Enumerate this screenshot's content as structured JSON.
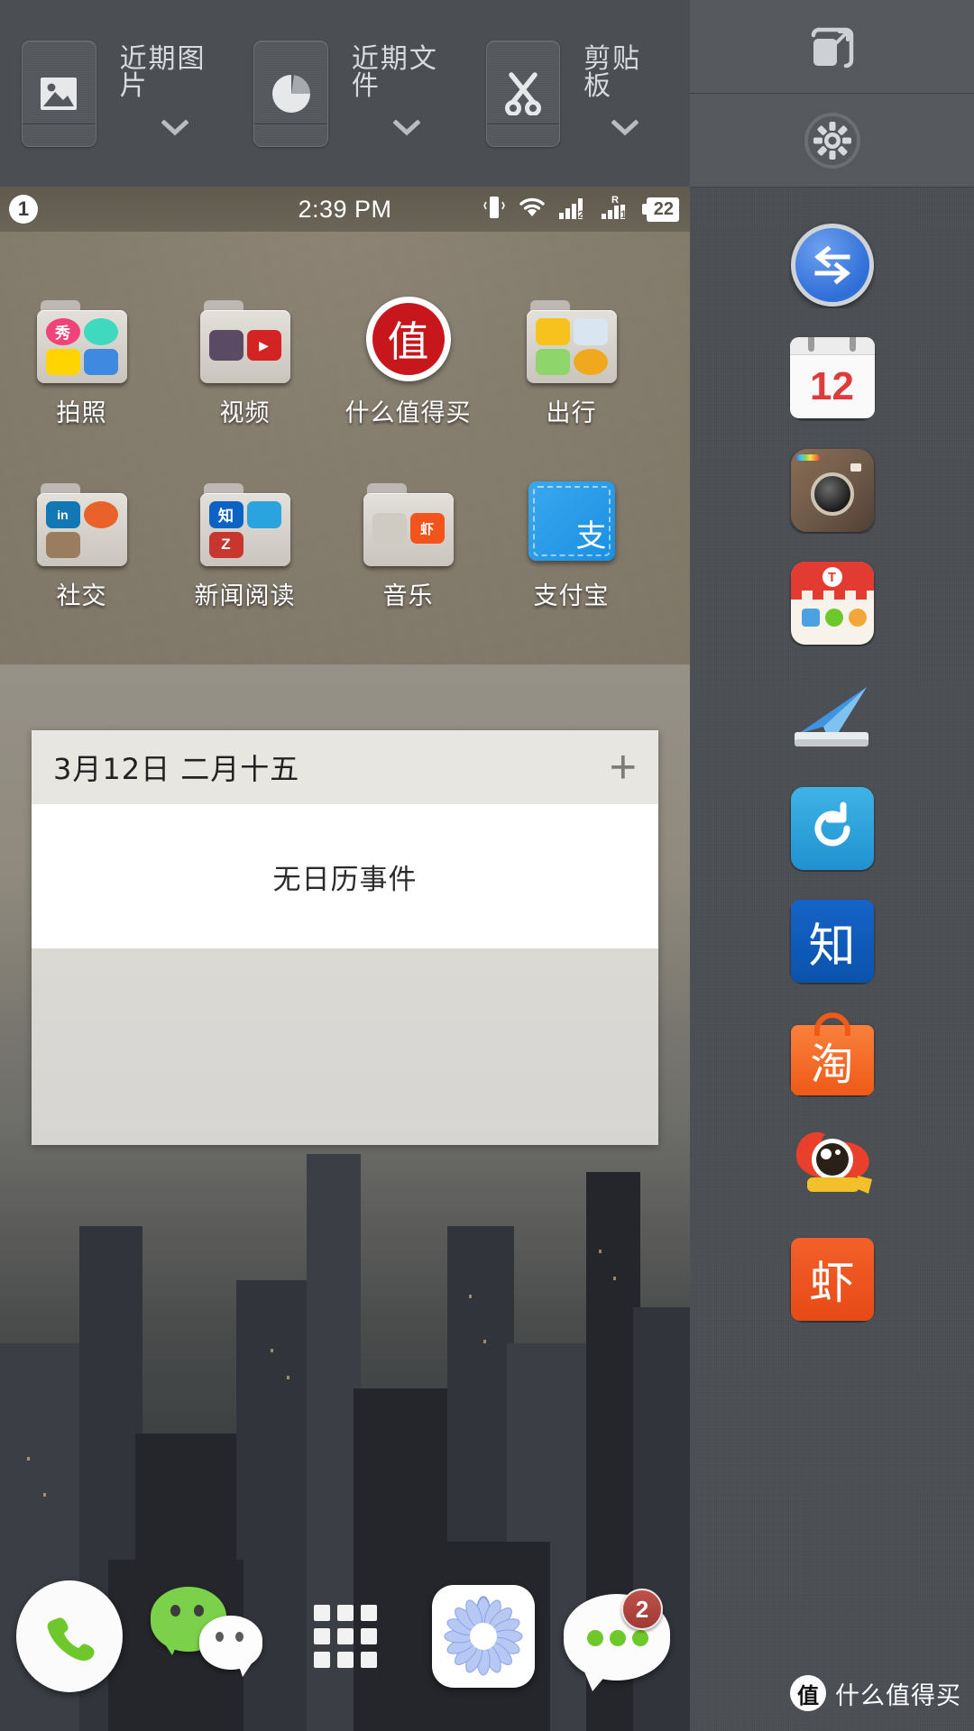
{
  "toolbar": {
    "items": [
      {
        "label": "近期图片",
        "icon": "image-icon",
        "caret": "chevron-down-icon"
      },
      {
        "label": "近期文件",
        "icon": "pie-chart-icon",
        "caret": "chevron-down-icon"
      },
      {
        "label": "剪贴板",
        "icon": "scissors-icon",
        "caret": "chevron-down-icon"
      }
    ]
  },
  "sidebar_header": {
    "multiwindow_icon": "multiwindow-expand-icon",
    "settings_icon": "gear-icon"
  },
  "statusbar": {
    "notification_count": "1",
    "time": "2:39 PM",
    "icons": [
      "vibrate-icon",
      "wifi-icon",
      "signal-2-icon",
      "signal-r-1-icon"
    ],
    "battery": "22"
  },
  "home": {
    "rows": [
      [
        {
          "label": "拍照",
          "type": "folder",
          "name": "folder-camera",
          "minis": [
            {
              "text": "秀",
              "bg": "#f0437a",
              "shape": "circle"
            },
            {
              "text": "",
              "bg": "#3fd9c0",
              "shape": "circle"
            },
            {
              "text": "",
              "bg": "#ffd400",
              "shape": "rounded"
            },
            {
              "text": "",
              "bg": "#3f8ae0",
              "shape": "rounded"
            }
          ]
        },
        {
          "label": "视频",
          "type": "folder",
          "name": "folder-video",
          "minis": [
            {
              "text": "",
              "bg": "#5a4a63",
              "shape": "rounded"
            },
            {
              "text": "▶",
              "bg": "#d32323",
              "shape": "rounded"
            },
            {
              "text": "",
              "bg": "#00000000",
              "shape": "none"
            },
            {
              "text": "",
              "bg": "#00000000",
              "shape": "none"
            }
          ],
          "two": true
        },
        {
          "label": "什么值得买",
          "type": "app",
          "name": "app-smzdm",
          "glyph": "值",
          "style": "smzdm"
        },
        {
          "label": "出行",
          "type": "folder",
          "name": "folder-travel",
          "minis": [
            {
              "text": "",
              "bg": "#f7c11e",
              "shape": "rounded"
            },
            {
              "text": "",
              "bg": "#d9e6f2",
              "shape": "rounded"
            },
            {
              "text": "",
              "bg": "#8ed66b",
              "shape": "rounded"
            },
            {
              "text": "",
              "bg": "#f0a81e",
              "shape": "rounded"
            }
          ]
        }
      ],
      [
        {
          "label": "社交",
          "type": "folder",
          "name": "folder-social",
          "minis": [
            {
              "text": "in",
              "bg": "#1277b5",
              "shape": "rounded"
            },
            {
              "text": "",
              "bg": "#e8622a",
              "shape": "circle"
            },
            {
              "text": "",
              "bg": "#9a7c5e",
              "shape": "rounded"
            },
            {
              "text": "",
              "bg": "#00000000",
              "shape": "none"
            }
          ]
        },
        {
          "label": "新闻阅读",
          "type": "folder",
          "name": "folder-news",
          "minis": [
            {
              "text": "知",
              "bg": "#0d63c4",
              "shape": "rounded"
            },
            {
              "text": "",
              "bg": "#2aa3df",
              "shape": "rounded"
            },
            {
              "text": "Z",
              "bg": "#c7362f",
              "shape": "rounded"
            },
            {
              "text": "",
              "bg": "#00000000",
              "shape": "none"
            }
          ]
        },
        {
          "label": "音乐",
          "type": "folder",
          "name": "folder-music",
          "minis": [
            {
              "text": "",
              "bg": "#cfcac2",
              "shape": "rounded"
            },
            {
              "text": "虾",
              "bg": "#f2541b",
              "shape": "rounded"
            },
            {
              "text": "",
              "bg": "#00000000",
              "shape": "none"
            },
            {
              "text": "",
              "bg": "#00000000",
              "shape": "none"
            }
          ],
          "two": true
        },
        {
          "label": "支付宝",
          "type": "app",
          "name": "app-alipay",
          "glyph": "支",
          "style": "alipay"
        }
      ]
    ]
  },
  "calendar_widget": {
    "date": "3月12日  二月十五",
    "add_icon": "plus-icon",
    "empty_text": "无日历事件"
  },
  "dock": {
    "items": [
      {
        "name": "dock-phone",
        "icon": "phone-icon",
        "badge": ""
      },
      {
        "name": "dock-wechat",
        "icon": "wechat-icon",
        "badge": ""
      },
      {
        "name": "dock-appdrawer",
        "icon": "app-grid-icon",
        "badge": ""
      },
      {
        "name": "dock-camera",
        "icon": "flower-camera-icon",
        "badge": ""
      },
      {
        "name": "dock-messages",
        "icon": "chat-bubble-icon",
        "badge": "2"
      }
    ]
  },
  "sidebar": {
    "items": [
      {
        "name": "sidebar-item-swap",
        "icon": "swap-arrows-icon",
        "label": ""
      },
      {
        "name": "sidebar-item-calendar",
        "icon": "calendar-icon",
        "label": "12"
      },
      {
        "name": "sidebar-item-instagram",
        "icon": "instagram-icon",
        "label": ""
      },
      {
        "name": "sidebar-item-taobao-shop",
        "icon": "shop-icon",
        "label": ""
      },
      {
        "name": "sidebar-item-paperplane",
        "icon": "paper-plane-icon",
        "label": ""
      },
      {
        "name": "sidebar-item-refresh",
        "icon": "circular-arrow-icon",
        "label": ""
      },
      {
        "name": "sidebar-item-zhihu",
        "icon": "zhihu-icon",
        "label": "知"
      },
      {
        "name": "sidebar-item-taobao",
        "icon": "taobao-icon",
        "label": "淘"
      },
      {
        "name": "sidebar-item-weibo",
        "icon": "weibo-icon",
        "label": ""
      },
      {
        "name": "sidebar-item-xiami",
        "icon": "xiami-icon",
        "label": "虾"
      }
    ]
  },
  "watermark": {
    "mark": "值",
    "text": "什么值得买"
  },
  "colors": {
    "panel": "#4a4d52",
    "panel_tile": "#55585d",
    "accent_blue": "#3f7fe0",
    "badge_red": "#b0443e",
    "wechat_green": "#7bd24a",
    "smzdm_red": "#c8161d"
  }
}
